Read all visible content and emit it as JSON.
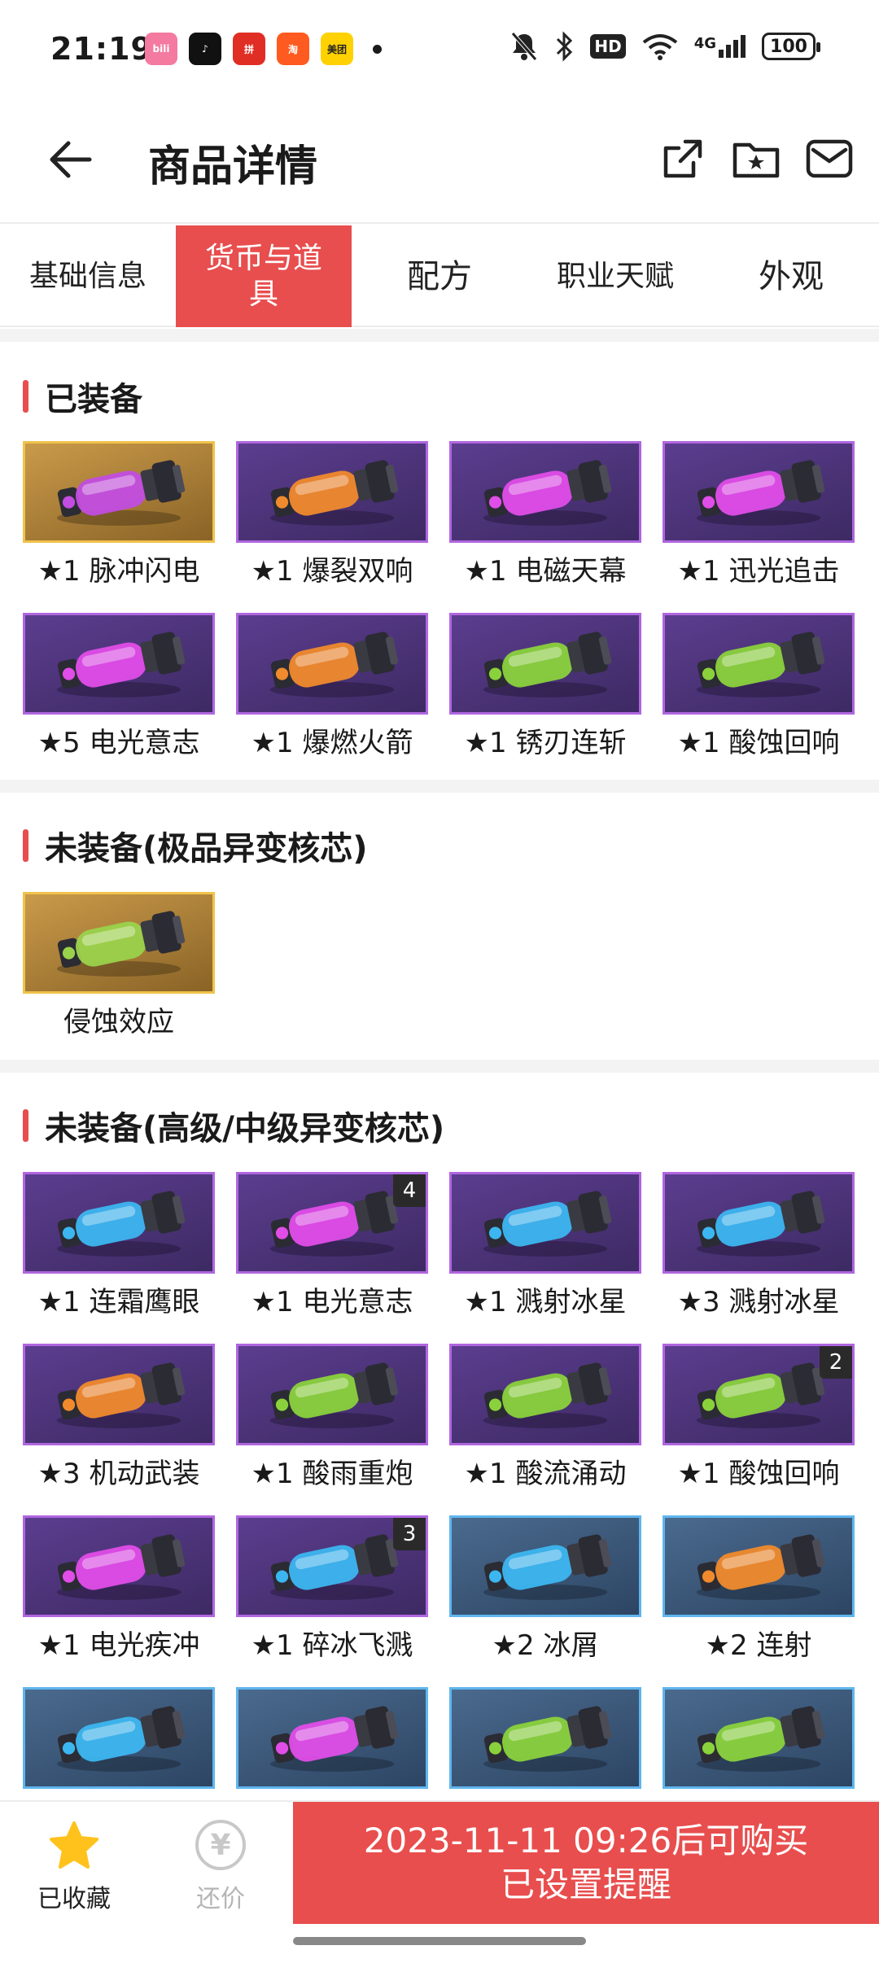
{
  "status_bar": {
    "time": "21:19",
    "apps": [
      {
        "name": "bilibili-app-icon",
        "label": "bili",
        "color": "#f47aa0"
      },
      {
        "name": "tiktok-app-icon",
        "label": "♪",
        "color": "#111111"
      },
      {
        "name": "pinduoduo-app-icon",
        "label": "拼",
        "color": "#e02e24"
      },
      {
        "name": "taobao-app-icon",
        "label": "淘",
        "color": "#ff5a1f"
      },
      {
        "name": "meituan-app-icon",
        "label": "美团",
        "color": "#ffd100"
      }
    ],
    "network": "4G",
    "hd": "HD",
    "battery": "100"
  },
  "header": {
    "title": "商品详情"
  },
  "tabs": [
    {
      "label": "基础信息",
      "active": false
    },
    {
      "label": "货币与道具",
      "active": true
    },
    {
      "label": "配方",
      "active": false
    },
    {
      "label": "职业天赋",
      "active": false
    },
    {
      "label": "外观",
      "active": false
    }
  ],
  "sections": {
    "equipped": {
      "title": "已装备",
      "items": [
        {
          "name": "★1 脉冲闪电",
          "frame": "gold",
          "core": "#c24de0"
        },
        {
          "name": "★1 爆裂双响",
          "frame": "purple",
          "core": "#f08a2c"
        },
        {
          "name": "★1 电磁天幕",
          "frame": "purple",
          "core": "#e04de8"
        },
        {
          "name": "★1 迅光追击",
          "frame": "purple",
          "core": "#e04de8"
        },
        {
          "name": "★5 电光意志",
          "frame": "purple",
          "core": "#e04de8"
        },
        {
          "name": "★1 爆燃火箭",
          "frame": "purple",
          "core": "#f08a2c"
        },
        {
          "name": "★1 锈刃连斩",
          "frame": "purple",
          "core": "#8ad23c"
        },
        {
          "name": "★1 酸蚀回响",
          "frame": "purple",
          "core": "#8ad23c"
        }
      ]
    },
    "unequipped_premium": {
      "title": "未装备(极品异变核芯)",
      "items": [
        {
          "name": "侵蚀效应",
          "frame": "gold",
          "core": "#9ad24c"
        }
      ]
    },
    "unequipped_mid": {
      "title": "未装备(高级/中级异变核芯)",
      "items": [
        {
          "name": "★1 连霜鹰眼",
          "frame": "purple",
          "core": "#3cb6f0",
          "count": ""
        },
        {
          "name": "★1 电光意志",
          "frame": "purple",
          "core": "#e04de8",
          "count": "4"
        },
        {
          "name": "★1 溅射冰星",
          "frame": "purple",
          "core": "#3cb6f0",
          "count": ""
        },
        {
          "name": "★3 溅射冰星",
          "frame": "purple",
          "core": "#3cb6f0",
          "count": ""
        },
        {
          "name": "★3 机动武装",
          "frame": "purple",
          "core": "#f08a2c",
          "count": ""
        },
        {
          "name": "★1 酸雨重炮",
          "frame": "purple",
          "core": "#8ad23c",
          "count": ""
        },
        {
          "name": "★1 酸流涌动",
          "frame": "purple",
          "core": "#8ad23c",
          "count": ""
        },
        {
          "name": "★1 酸蚀回响",
          "frame": "purple",
          "core": "#8ad23c",
          "count": "2"
        },
        {
          "name": "★1 电光疾冲",
          "frame": "purple",
          "core": "#e04de8",
          "count": ""
        },
        {
          "name": "★1 碎冰飞溅",
          "frame": "purple",
          "core": "#3cb6f0",
          "count": "3"
        },
        {
          "name": "★2 冰屑",
          "frame": "blue",
          "core": "#3cb6f0",
          "count": ""
        },
        {
          "name": "★2 连射",
          "frame": "blue",
          "core": "#f08a2c",
          "count": ""
        },
        {
          "name": "",
          "frame": "blue",
          "core": "#3cb6f0",
          "count": ""
        },
        {
          "name": "",
          "frame": "blue",
          "core": "#e04de8",
          "count": ""
        },
        {
          "name": "",
          "frame": "blue",
          "core": "#8ad23c",
          "count": ""
        },
        {
          "name": "",
          "frame": "blue",
          "core": "#8ad23c",
          "count": ""
        }
      ]
    }
  },
  "bottom_bar": {
    "favorite_label": "已收藏",
    "bargain_label": "还价",
    "bargain_symbol": "¥",
    "buy_line1": "2023-11-11 09:26后可购买",
    "buy_line2": "已设置提醒"
  }
}
